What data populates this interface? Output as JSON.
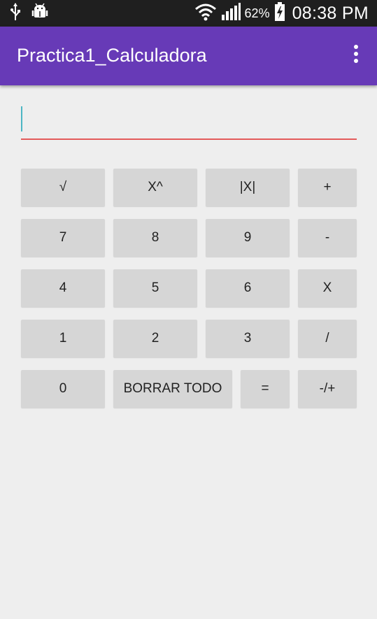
{
  "status_bar": {
    "icons_left": [
      "usb-icon",
      "android-debug-icon"
    ],
    "icons_right": [
      "wifi-icon",
      "signal-icon",
      "battery-charging-icon"
    ],
    "battery_percent": "62%",
    "time": "08:38 PM"
  },
  "app_bar": {
    "title": "Practica1_Calculadora",
    "menu_icon": "overflow-menu-icon",
    "color": "#673ab7"
  },
  "input": {
    "value": "",
    "placeholder": "",
    "underline_color": "#e35a5a",
    "cursor_color": "#4db6c4"
  },
  "keypad": {
    "row1": [
      "√",
      "X^",
      "|X|",
      "+"
    ],
    "row2": [
      "7",
      "8",
      "9",
      "-"
    ],
    "row3": [
      "4",
      "5",
      "6",
      "X"
    ],
    "row4": [
      "1",
      "2",
      "3",
      "/"
    ],
    "row5": [
      "0",
      "BORRAR TODO",
      "=",
      "-/+"
    ]
  },
  "colors": {
    "background": "#eeeeee",
    "button": "#d6d6d6",
    "status_bar": "#1f1f1f"
  }
}
